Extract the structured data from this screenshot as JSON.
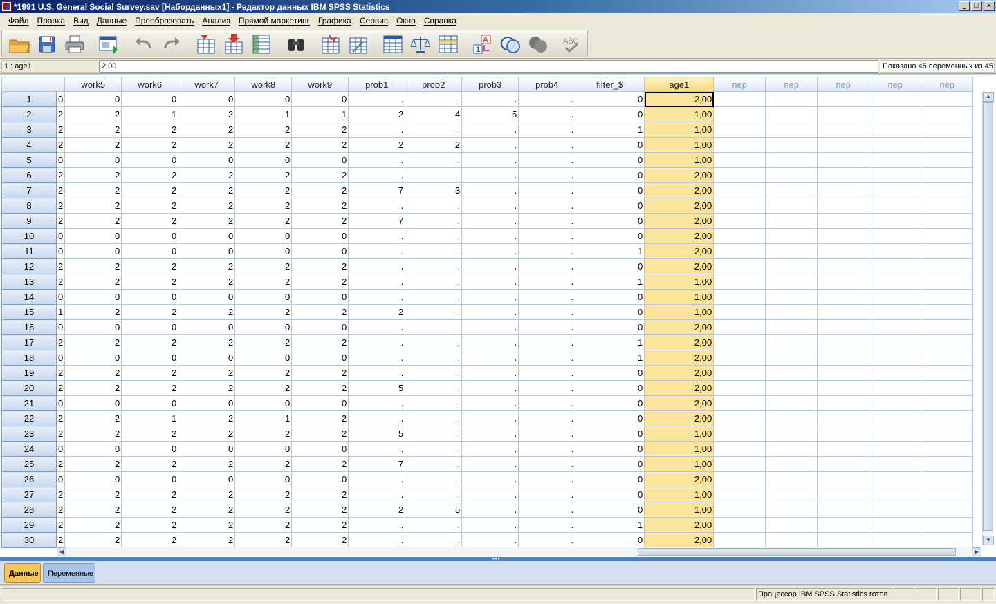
{
  "window": {
    "title": "*1991 U.S. General Social Survey.sav [Наборданных1] - Редактор данных IBM SPSS Statistics",
    "minimize_glyph": "_",
    "restore_glyph": "❐",
    "close_glyph": "✕"
  },
  "menu": [
    "Файл",
    "Правка",
    "Вид",
    "Данные",
    "Преобразовать",
    "Анализ",
    "Прямой маркетинг",
    "Графика",
    "Сервис",
    "Окно",
    "Справка"
  ],
  "toolbar_icons": [
    "open-folder-icon",
    "save-icon",
    "print-icon",
    "dialog-recall-icon",
    "undo-icon",
    "redo-icon",
    "goto-case-icon",
    "goto-variable-icon",
    "variables-icon",
    "find-icon",
    "insert-cases-icon",
    "insert-variable-icon",
    "split-file-icon",
    "weight-cases-icon",
    "select-cases-icon",
    "value-labels-icon",
    "use-sets-icon",
    "show-all-variables-icon",
    "spell-check-icon"
  ],
  "cell_editor": {
    "reference": "1 : age1",
    "value": "2,00",
    "visible_count": "Показано 45 переменных из 45"
  },
  "columns": [
    "",
    "work5",
    "work6",
    "work7",
    "work8",
    "work9",
    "prob1",
    "prob2",
    "prob3",
    "prob4",
    "filter_$",
    "age1",
    "пер",
    "пер",
    "пер",
    "пер",
    "пер"
  ],
  "rows": [
    [
      "1",
      "0",
      "0",
      "0",
      "0",
      "0",
      "0",
      ".",
      ".",
      ".",
      ".",
      "0",
      "2,00"
    ],
    [
      "2",
      "2",
      "2",
      "1",
      "2",
      "1",
      "1",
      "2",
      "4",
      "5",
      ".",
      "0",
      "1,00"
    ],
    [
      "3",
      "2",
      "2",
      "2",
      "2",
      "2",
      "2",
      ".",
      ".",
      ".",
      ".",
      "1",
      "1,00"
    ],
    [
      "4",
      "2",
      "2",
      "2",
      "2",
      "2",
      "2",
      "2",
      "2",
      ".",
      ".",
      "0",
      "1,00"
    ],
    [
      "5",
      "0",
      "0",
      "0",
      "0",
      "0",
      "0",
      ".",
      ".",
      ".",
      ".",
      "0",
      "1,00"
    ],
    [
      "6",
      "2",
      "2",
      "2",
      "2",
      "2",
      "2",
      ".",
      ".",
      ".",
      ".",
      "0",
      "2,00"
    ],
    [
      "7",
      "2",
      "2",
      "2",
      "2",
      "2",
      "2",
      "7",
      "3",
      ".",
      ".",
      "0",
      "2,00"
    ],
    [
      "8",
      "2",
      "2",
      "2",
      "2",
      "2",
      "2",
      ".",
      ".",
      ".",
      ".",
      "0",
      "2,00"
    ],
    [
      "9",
      "2",
      "2",
      "2",
      "2",
      "2",
      "2",
      "7",
      ".",
      ".",
      ".",
      "0",
      "2,00"
    ],
    [
      "10",
      "0",
      "0",
      "0",
      "0",
      "0",
      "0",
      ".",
      ".",
      ".",
      ".",
      "0",
      "2,00"
    ],
    [
      "11",
      "0",
      "0",
      "0",
      "0",
      "0",
      "0",
      ".",
      ".",
      ".",
      ".",
      "1",
      "2,00"
    ],
    [
      "12",
      "2",
      "2",
      "2",
      "2",
      "2",
      "2",
      ".",
      ".",
      ".",
      ".",
      "0",
      "2,00"
    ],
    [
      "13",
      "2",
      "2",
      "2",
      "2",
      "2",
      "2",
      ".",
      ".",
      ".",
      ".",
      "1",
      "1,00"
    ],
    [
      "14",
      "0",
      "0",
      "0",
      "0",
      "0",
      "0",
      ".",
      ".",
      ".",
      ".",
      "0",
      "1,00"
    ],
    [
      "15",
      "1",
      "2",
      "2",
      "2",
      "2",
      "2",
      "2",
      ".",
      ".",
      ".",
      "0",
      "1,00"
    ],
    [
      "16",
      "0",
      "0",
      "0",
      "0",
      "0",
      "0",
      ".",
      ".",
      ".",
      ".",
      "0",
      "2,00"
    ],
    [
      "17",
      "2",
      "2",
      "2",
      "2",
      "2",
      "2",
      ".",
      ".",
      ".",
      ".",
      "1",
      "2,00"
    ],
    [
      "18",
      "0",
      "0",
      "0",
      "0",
      "0",
      "0",
      ".",
      ".",
      ".",
      ".",
      "1",
      "2,00"
    ],
    [
      "19",
      "2",
      "2",
      "2",
      "2",
      "2",
      "2",
      ".",
      ".",
      ".",
      ".",
      "0",
      "2,00"
    ],
    [
      "20",
      "2",
      "2",
      "2",
      "2",
      "2",
      "2",
      "5",
      ".",
      ".",
      ".",
      "0",
      "2,00"
    ],
    [
      "21",
      "0",
      "0",
      "0",
      "0",
      "0",
      "0",
      ".",
      ".",
      ".",
      ".",
      "0",
      "2,00"
    ],
    [
      "22",
      "2",
      "2",
      "1",
      "2",
      "1",
      "2",
      ".",
      ".",
      ".",
      ".",
      "0",
      "2,00"
    ],
    [
      "23",
      "2",
      "2",
      "2",
      "2",
      "2",
      "2",
      "5",
      ".",
      ".",
      ".",
      "0",
      "1,00"
    ],
    [
      "24",
      "0",
      "0",
      "0",
      "0",
      "0",
      "0",
      ".",
      ".",
      ".",
      ".",
      "0",
      "1,00"
    ],
    [
      "25",
      "2",
      "2",
      "2",
      "2",
      "2",
      "2",
      "7",
      ".",
      ".",
      ".",
      "0",
      "1,00"
    ],
    [
      "26",
      "0",
      "0",
      "0",
      "0",
      "0",
      "0",
      ".",
      ".",
      ".",
      ".",
      "0",
      "2,00"
    ],
    [
      "27",
      "2",
      "2",
      "2",
      "2",
      "2",
      "2",
      ".",
      ".",
      ".",
      ".",
      "0",
      "1,00"
    ],
    [
      "28",
      "2",
      "2",
      "2",
      "2",
      "2",
      "2",
      "2",
      "5",
      ".",
      ".",
      "0",
      "1,00"
    ],
    [
      "29",
      "2",
      "2",
      "2",
      "2",
      "2",
      "2",
      ".",
      ".",
      ".",
      ".",
      "1",
      "2,00"
    ],
    [
      "30",
      "2",
      "2",
      "2",
      "2",
      "2",
      "2",
      ".",
      ".",
      ".",
      ".",
      "0",
      "2,00"
    ]
  ],
  "tabs": {
    "data": "Данные",
    "variables": "Переменные"
  },
  "status": {
    "processor": "Процессор IBM SPSS Statistics  готов"
  },
  "colors": {
    "selected_column": "#fce49b",
    "title_bar": "#0a246a",
    "active_tab": "#f5c75a"
  }
}
